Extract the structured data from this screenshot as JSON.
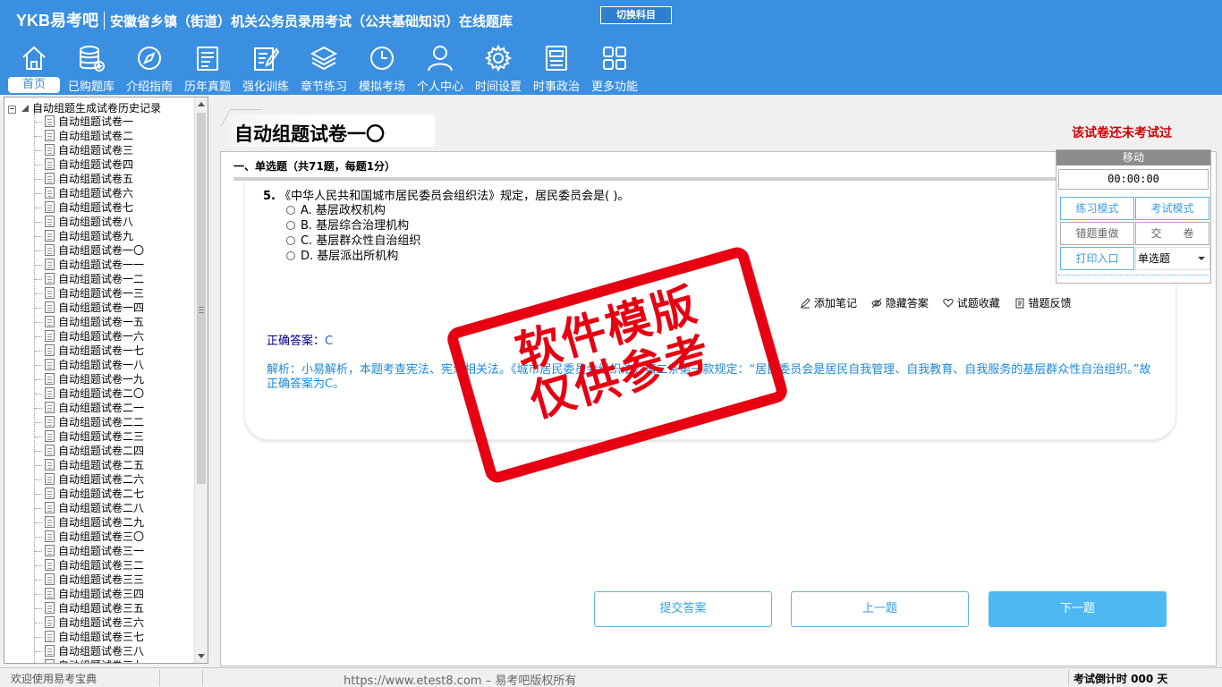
{
  "header": {
    "logo": "YKB易考吧",
    "title": "安徽省乡镇（街道）机关公务员录用考试（公共基础知识）在线题库",
    "switch_label": "切换科目"
  },
  "nav": [
    {
      "label": "首页",
      "icon": "home-icon"
    },
    {
      "label": "已购题库",
      "icon": "database-icon"
    },
    {
      "label": "介绍指南",
      "icon": "compass-icon"
    },
    {
      "label": "历年真题",
      "icon": "checklist-icon"
    },
    {
      "label": "强化训练",
      "icon": "edit-icon"
    },
    {
      "label": "章节练习",
      "icon": "layers-icon"
    },
    {
      "label": "模拟考场",
      "icon": "clock-icon"
    },
    {
      "label": "个人中心",
      "icon": "user-icon"
    },
    {
      "label": "时间设置",
      "icon": "gear-icon"
    },
    {
      "label": "时事政治",
      "icon": "newspaper-icon"
    },
    {
      "label": "更多功能",
      "icon": "grid-icon"
    }
  ],
  "tree": {
    "root": "自动组题生成试卷历史记录",
    "items": [
      "自动组题试卷一",
      "自动组题试卷二",
      "自动组题试卷三",
      "自动组题试卷四",
      "自动组题试卷五",
      "自动组题试卷六",
      "自动组题试卷七",
      "自动组题试卷八",
      "自动组题试卷九",
      "自动组题试卷一〇",
      "自动组题试卷一一",
      "自动组题试卷一二",
      "自动组题试卷一三",
      "自动组题试卷一四",
      "自动组题试卷一五",
      "自动组题试卷一六",
      "自动组题试卷一七",
      "自动组题试卷一八",
      "自动组题试卷一九",
      "自动组题试卷二〇",
      "自动组题试卷二一",
      "自动组题试卷二二",
      "自动组题试卷二三",
      "自动组题试卷二四",
      "自动组题试卷二五",
      "自动组题试卷二六",
      "自动组题试卷二七",
      "自动组题试卷二八",
      "自动组题试卷二九",
      "自动组题试卷三〇",
      "自动组题试卷三一",
      "自动组题试卷三二",
      "自动组题试卷三三",
      "自动组题试卷三四",
      "自动组题试卷三五",
      "自动组题试卷三六",
      "自动组题试卷三七",
      "自动组题试卷三八",
      "自动组题试卷三九"
    ]
  },
  "main": {
    "paper_title": "自动组题试卷一〇",
    "status": "该试卷还未考试过",
    "section_title": "一、单选题（共71题，每题1分）",
    "question": {
      "number": "5.",
      "text": "《中华人民共和国城市居民委员会组织法》规定，居民委员会是( )。",
      "options": [
        "A. 基层政权机构",
        "B. 基层综合治理机构",
        "C. 基层群众性自治组织",
        "D. 基层派出所机构"
      ]
    },
    "actions": [
      "添加笔记",
      "隐藏答案",
      "试题收藏",
      "错题反馈"
    ],
    "answer_label": "正确答案：",
    "answer_value": "C",
    "analysis": "解析：小易解析，本题考查宪法、宪法相关法。《城市居民委员会组织法》第二条第一款规定：“居民委员会是居民自我管理、自我教育、自我服务的基层群众性自治组织。”故正确答案为C。",
    "buttons": {
      "submit": "提交答案",
      "prev": "上一题",
      "next": "下一题"
    }
  },
  "float_panel": {
    "move": "移动",
    "timer": "00:00:00",
    "practice_mode": "练习模式",
    "exam_mode": "考试模式",
    "redo_wrong": "错题重做",
    "hand_in": "交　　卷",
    "print": "打印入口",
    "type_select": "单选题"
  },
  "watermark": {
    "line1": "软件模版",
    "line2": "仅供参考"
  },
  "statusbar": {
    "welcome": "欢迎使用易考宝典",
    "copyright": "https://www.etest8.com – 易考吧版权所有",
    "countdown": "考试倒计时 000 天"
  },
  "colors": {
    "header": "#3a8fe0",
    "accent": "#4db8f2",
    "status_red": "#d00000",
    "stamp_red": "#e60012"
  }
}
